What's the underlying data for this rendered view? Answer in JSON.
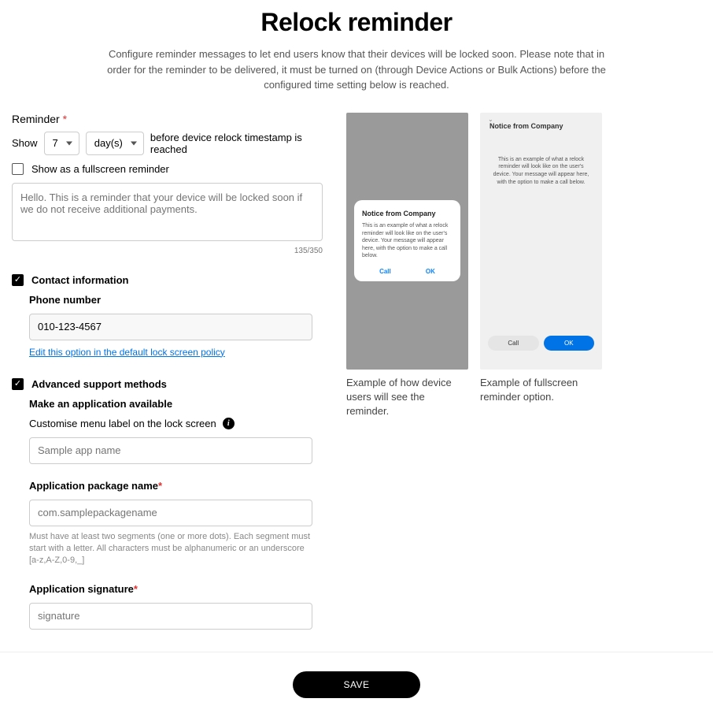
{
  "header": {
    "title": "Relock reminder",
    "description": "Configure reminder messages to let end users know that their devices will be locked soon. Please note that in order for the reminder to be delivered, it must be turned on (through Device Actions or Bulk Actions) before the configured time setting below is reached."
  },
  "reminder": {
    "label": "Reminder",
    "show_label": "Show",
    "number_value": "7",
    "unit_value": "day(s)",
    "suffix": "before device relock timestamp is reached",
    "fullscreen_checkbox_label": "Show as a fullscreen reminder",
    "fullscreen_checked": false,
    "message_placeholder": "Hello. This is a reminder that your device will be locked soon if we do not receive additional payments.",
    "char_count": "135/350"
  },
  "contact": {
    "checkbox_label": "Contact information",
    "checked": true,
    "phone_label": "Phone number",
    "phone_value": "010-123-4567",
    "edit_link": "Edit this option in the default lock screen policy"
  },
  "advanced": {
    "checkbox_label": "Advanced support methods",
    "checked": true,
    "make_available_label": "Make an application available",
    "customise_label": "Customise menu label on the lock screen",
    "app_name_placeholder": "Sample app name",
    "package_label": "Application package name",
    "package_placeholder": "com.samplepackagename",
    "package_helper": "Must have at least two segments (one or more dots). Each segment must start with a letter. All characters must be alphanumeric or an underscore [a-z,A-Z,0-9,_]",
    "signature_label": "Application signature",
    "signature_placeholder": "signature"
  },
  "preview": {
    "dialog": {
      "title": "Notice from Company",
      "body": "This is an example of what a relock reminder will look like on the user's device. Your message will appear here, with the option to make a call below.",
      "call": "Call",
      "ok": "OK",
      "caption": "Example of how device users will see the reminder."
    },
    "fullscreen": {
      "title": "Notice from Company",
      "body": "This is an example of what a relock reminder will look like on the user's device. Your message will appear here, with the option to make a call below.",
      "call": "Call",
      "ok": "OK",
      "caption": "Example of fullscreen reminder option."
    }
  },
  "footer": {
    "save": "SAVE"
  }
}
